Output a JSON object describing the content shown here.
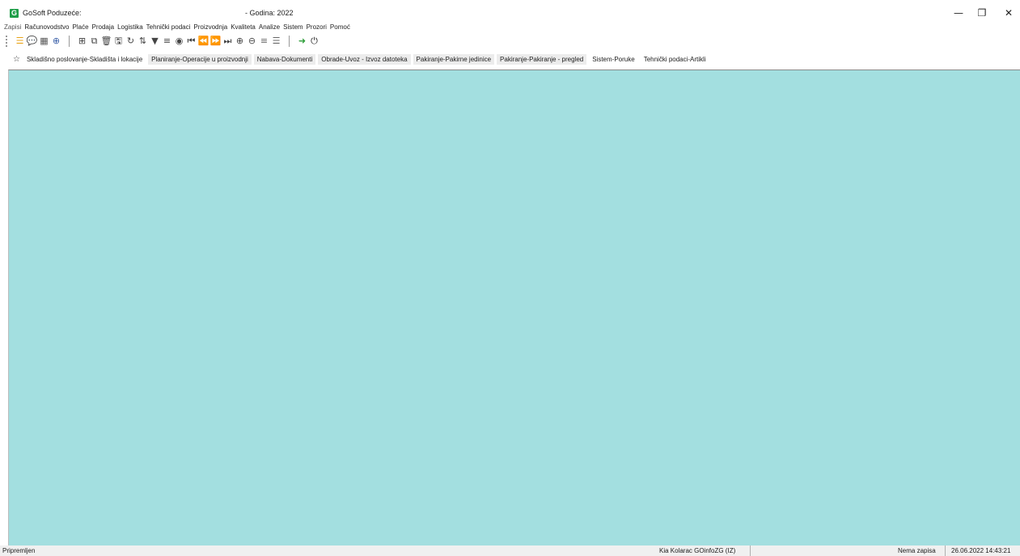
{
  "titlebar": {
    "logo": "G",
    "app_name": "GoSoft",
    "company_label": "Poduzeće:",
    "year_text": "- Godina: 2022",
    "minimize": "—",
    "restore": "❐",
    "close": "✕"
  },
  "menu": {
    "items": [
      "Zapisi",
      "Računovodstvo",
      "Plaće",
      "Prodaja",
      "Logistika",
      "Tehnički podaci",
      "Proizvodnja",
      "Kvaliteta",
      "Analize",
      "Sistem",
      "Prozori",
      "Pomoć"
    ]
  },
  "toolbar": {
    "icons": [
      {
        "name": "menu-icon",
        "glyph": "☰",
        "color": "#e8a317"
      },
      {
        "name": "chat-icon",
        "glyph": "💬",
        "color": "#333333"
      },
      {
        "name": "calculator-icon",
        "glyph": "▦",
        "color": "#555555"
      },
      {
        "name": "globe-icon",
        "glyph": "⊕",
        "color": "#3a5fa8"
      },
      {
        "name": "new-record-icon",
        "glyph": "⊞",
        "color": "#444444"
      },
      {
        "name": "copy-icon",
        "glyph": "⧉",
        "color": "#444444"
      },
      {
        "name": "delete-icon",
        "glyph": "🗑",
        "color": "#444444"
      },
      {
        "name": "save-icon",
        "glyph": "🖫",
        "color": "#444444"
      },
      {
        "name": "refresh-icon",
        "glyph": "↻",
        "color": "#444444"
      },
      {
        "name": "sort-icon",
        "glyph": "⇅",
        "color": "#444444"
      },
      {
        "name": "filter-icon",
        "glyph": "▼",
        "color": "#444444"
      },
      {
        "name": "filter-list-icon",
        "glyph": "≡",
        "color": "#444444"
      },
      {
        "name": "view-icon",
        "glyph": "◉",
        "color": "#444444"
      },
      {
        "name": "first-record-icon",
        "glyph": "⏮",
        "color": "#444444"
      },
      {
        "name": "previous-record-icon",
        "glyph": "⏪",
        "color": "#444444"
      },
      {
        "name": "next-record-icon",
        "glyph": "⏩",
        "color": "#444444"
      },
      {
        "name": "last-record-icon",
        "glyph": "⏭",
        "color": "#444444"
      },
      {
        "name": "zoom-in-icon",
        "glyph": "⊕",
        "color": "#444444"
      },
      {
        "name": "zoom-out-icon",
        "glyph": "⊖",
        "color": "#444444"
      },
      {
        "name": "align-icon",
        "glyph": "≡",
        "color": "#666666"
      },
      {
        "name": "list-icon",
        "glyph": "☰",
        "color": "#666666"
      },
      {
        "name": "exit-icon",
        "glyph": "➜",
        "color": "#2e9e3a"
      },
      {
        "name": "power-icon",
        "glyph": "⏻",
        "color": "#222222"
      }
    ]
  },
  "tabs": [
    {
      "label": "Skladišno poslovanje-Skladišta i lokacije",
      "shaded": false
    },
    {
      "label": "Planiranje-Operacije u proizvodnji",
      "shaded": true
    },
    {
      "label": "Nabava-Dokumenti",
      "shaded": true
    },
    {
      "label": "Obrade-Uvoz - Izvoz datoteka",
      "shaded": true
    },
    {
      "label": "Pakiranje-Pakirne jedinice",
      "shaded": true
    },
    {
      "label": "Pakiranje-Pakiranje - pregled",
      "shaded": true
    },
    {
      "label": "Sistem-Poruke",
      "shaded": false
    },
    {
      "label": "Tehnički podaci-Artikli",
      "shaded": false
    }
  ],
  "workspace": {
    "background": "#a3dfe0"
  },
  "status": {
    "left": "Pripremljen",
    "user": "Kia Kolarac GOinfoZG  (IZ)",
    "records": "Nema zapisa",
    "datetime": "26.06.2022 14:43:21"
  }
}
